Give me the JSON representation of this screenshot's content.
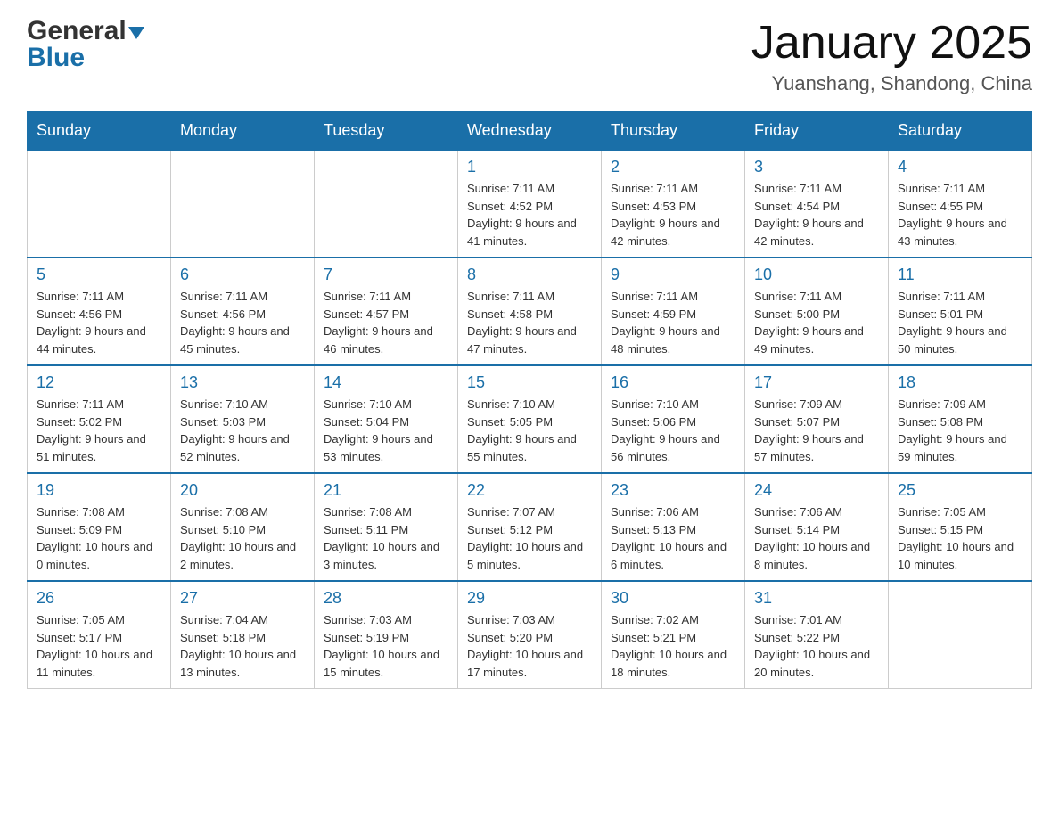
{
  "header": {
    "logo_general": "General",
    "logo_blue": "Blue",
    "title": "January 2025",
    "subtitle": "Yuanshang, Shandong, China"
  },
  "days_of_week": [
    "Sunday",
    "Monday",
    "Tuesday",
    "Wednesday",
    "Thursday",
    "Friday",
    "Saturday"
  ],
  "weeks": [
    [
      {
        "day": "",
        "info": ""
      },
      {
        "day": "",
        "info": ""
      },
      {
        "day": "",
        "info": ""
      },
      {
        "day": "1",
        "info": "Sunrise: 7:11 AM\nSunset: 4:52 PM\nDaylight: 9 hours\nand 41 minutes."
      },
      {
        "day": "2",
        "info": "Sunrise: 7:11 AM\nSunset: 4:53 PM\nDaylight: 9 hours\nand 42 minutes."
      },
      {
        "day": "3",
        "info": "Sunrise: 7:11 AM\nSunset: 4:54 PM\nDaylight: 9 hours\nand 42 minutes."
      },
      {
        "day": "4",
        "info": "Sunrise: 7:11 AM\nSunset: 4:55 PM\nDaylight: 9 hours\nand 43 minutes."
      }
    ],
    [
      {
        "day": "5",
        "info": "Sunrise: 7:11 AM\nSunset: 4:56 PM\nDaylight: 9 hours\nand 44 minutes."
      },
      {
        "day": "6",
        "info": "Sunrise: 7:11 AM\nSunset: 4:56 PM\nDaylight: 9 hours\nand 45 minutes."
      },
      {
        "day": "7",
        "info": "Sunrise: 7:11 AM\nSunset: 4:57 PM\nDaylight: 9 hours\nand 46 minutes."
      },
      {
        "day": "8",
        "info": "Sunrise: 7:11 AM\nSunset: 4:58 PM\nDaylight: 9 hours\nand 47 minutes."
      },
      {
        "day": "9",
        "info": "Sunrise: 7:11 AM\nSunset: 4:59 PM\nDaylight: 9 hours\nand 48 minutes."
      },
      {
        "day": "10",
        "info": "Sunrise: 7:11 AM\nSunset: 5:00 PM\nDaylight: 9 hours\nand 49 minutes."
      },
      {
        "day": "11",
        "info": "Sunrise: 7:11 AM\nSunset: 5:01 PM\nDaylight: 9 hours\nand 50 minutes."
      }
    ],
    [
      {
        "day": "12",
        "info": "Sunrise: 7:11 AM\nSunset: 5:02 PM\nDaylight: 9 hours\nand 51 minutes."
      },
      {
        "day": "13",
        "info": "Sunrise: 7:10 AM\nSunset: 5:03 PM\nDaylight: 9 hours\nand 52 minutes."
      },
      {
        "day": "14",
        "info": "Sunrise: 7:10 AM\nSunset: 5:04 PM\nDaylight: 9 hours\nand 53 minutes."
      },
      {
        "day": "15",
        "info": "Sunrise: 7:10 AM\nSunset: 5:05 PM\nDaylight: 9 hours\nand 55 minutes."
      },
      {
        "day": "16",
        "info": "Sunrise: 7:10 AM\nSunset: 5:06 PM\nDaylight: 9 hours\nand 56 minutes."
      },
      {
        "day": "17",
        "info": "Sunrise: 7:09 AM\nSunset: 5:07 PM\nDaylight: 9 hours\nand 57 minutes."
      },
      {
        "day": "18",
        "info": "Sunrise: 7:09 AM\nSunset: 5:08 PM\nDaylight: 9 hours\nand 59 minutes."
      }
    ],
    [
      {
        "day": "19",
        "info": "Sunrise: 7:08 AM\nSunset: 5:09 PM\nDaylight: 10 hours\nand 0 minutes."
      },
      {
        "day": "20",
        "info": "Sunrise: 7:08 AM\nSunset: 5:10 PM\nDaylight: 10 hours\nand 2 minutes."
      },
      {
        "day": "21",
        "info": "Sunrise: 7:08 AM\nSunset: 5:11 PM\nDaylight: 10 hours\nand 3 minutes."
      },
      {
        "day": "22",
        "info": "Sunrise: 7:07 AM\nSunset: 5:12 PM\nDaylight: 10 hours\nand 5 minutes."
      },
      {
        "day": "23",
        "info": "Sunrise: 7:06 AM\nSunset: 5:13 PM\nDaylight: 10 hours\nand 6 minutes."
      },
      {
        "day": "24",
        "info": "Sunrise: 7:06 AM\nSunset: 5:14 PM\nDaylight: 10 hours\nand 8 minutes."
      },
      {
        "day": "25",
        "info": "Sunrise: 7:05 AM\nSunset: 5:15 PM\nDaylight: 10 hours\nand 10 minutes."
      }
    ],
    [
      {
        "day": "26",
        "info": "Sunrise: 7:05 AM\nSunset: 5:17 PM\nDaylight: 10 hours\nand 11 minutes."
      },
      {
        "day": "27",
        "info": "Sunrise: 7:04 AM\nSunset: 5:18 PM\nDaylight: 10 hours\nand 13 minutes."
      },
      {
        "day": "28",
        "info": "Sunrise: 7:03 AM\nSunset: 5:19 PM\nDaylight: 10 hours\nand 15 minutes."
      },
      {
        "day": "29",
        "info": "Sunrise: 7:03 AM\nSunset: 5:20 PM\nDaylight: 10 hours\nand 17 minutes."
      },
      {
        "day": "30",
        "info": "Sunrise: 7:02 AM\nSunset: 5:21 PM\nDaylight: 10 hours\nand 18 minutes."
      },
      {
        "day": "31",
        "info": "Sunrise: 7:01 AM\nSunset: 5:22 PM\nDaylight: 10 hours\nand 20 minutes."
      },
      {
        "day": "",
        "info": ""
      }
    ]
  ]
}
